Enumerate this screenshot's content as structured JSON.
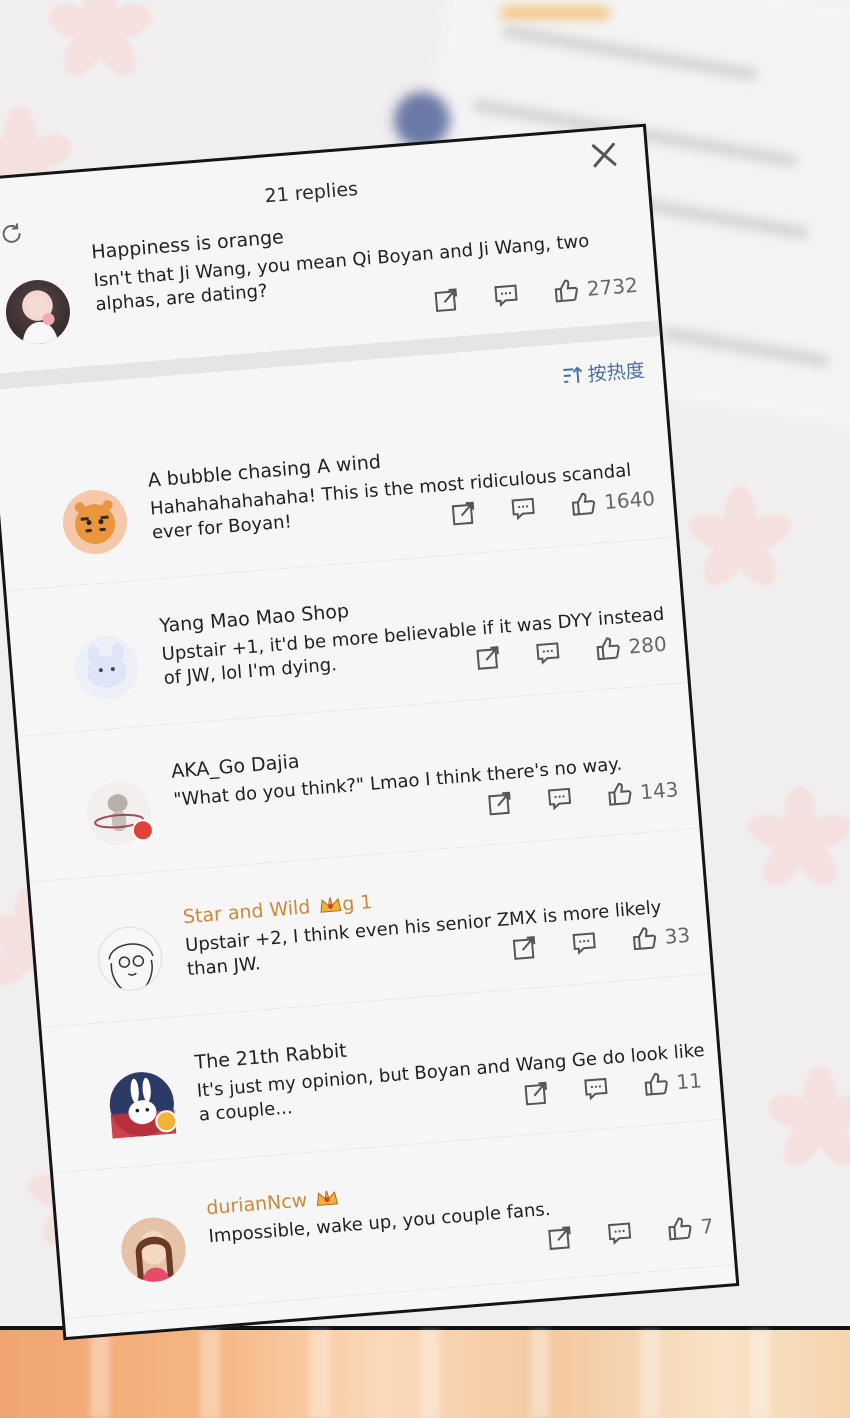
{
  "header": {
    "replies_count": "21 replies"
  },
  "original_comment": {
    "username": "Happiness is orange",
    "text": "Isn't that Ji Wang, you mean Qi Boyan and Ji Wang, two alphas, are dating?",
    "likes": "2732"
  },
  "sort": {
    "label": "按热度"
  },
  "replies": [
    {
      "username": "A bubble chasing A wind",
      "text": "Hahahahahahaha! This is the most ridiculous scandal ever for Boyan!",
      "likes": "1640",
      "avatar": "tiger",
      "gold": false
    },
    {
      "username": "Yang Mao Mao Shop",
      "text": "Upstair +1, it'd be more believable if it was DYY instead of JW, lol I'm dying.",
      "likes": "280",
      "avatar": "bunny-plush",
      "gold": false
    },
    {
      "username": "AKA_Go Dajia",
      "text": "\"What do you think?\" Lmao I think there's no way.",
      "likes": "143",
      "avatar": "cat-hoop",
      "gold": false
    },
    {
      "username": "Star and Wild",
      "username_suffix": "g 1",
      "text": "Upstair +2, I think even his senior ZMX is more likely than JW.",
      "likes": "33",
      "avatar": "sketch-girl",
      "gold": true
    },
    {
      "username": "The 21th Rabbit",
      "text": "It's just my opinion, but Boyan and Wang Ge do look like a couple...",
      "likes": "11",
      "avatar": "rabbit",
      "gold": false
    },
    {
      "username": "durianNcw",
      "text": "Impossible, wake up, you couple fans.",
      "likes": "7",
      "avatar": "girl-photo",
      "gold": true
    }
  ],
  "colors": {
    "gold_name": "#c98a3a",
    "sort_blue": "#4a6fa5",
    "panel_bg": "#f7f6f7",
    "border": "#151515"
  }
}
